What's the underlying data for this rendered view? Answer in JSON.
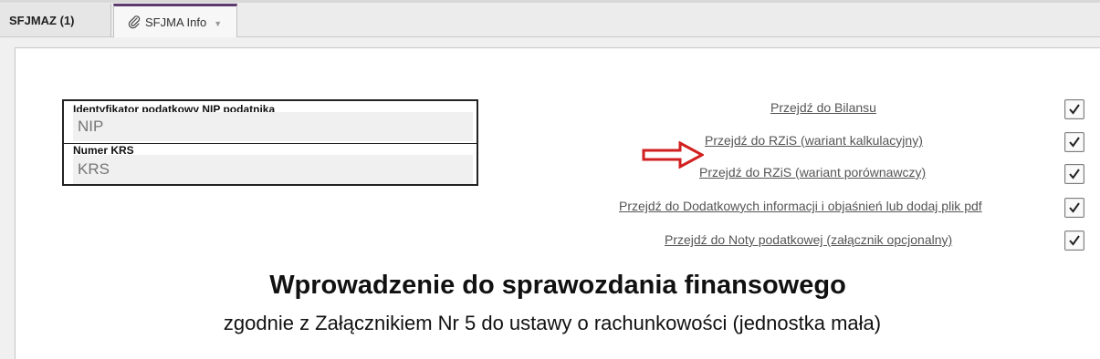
{
  "tabs": [
    {
      "label": "SFJMAZ (1)"
    },
    {
      "label": "SFJMA Info",
      "icon": "paperclip-icon",
      "dropdown_icon": "chevron-down-icon"
    }
  ],
  "identity": {
    "nip_label": "Identyfikator podatkowy NIP podatnika",
    "nip_placeholder": "NIP",
    "krs_label": "Numer KRS",
    "krs_placeholder": "KRS"
  },
  "links": [
    {
      "label": "Przejdź do Bilansu",
      "checked": true
    },
    {
      "label": "Przejdź do RZiS (wariant kalkulacyjny)",
      "checked": true
    },
    {
      "label": "Przejdź do RZiS (wariant porównawczy)",
      "checked": true
    },
    {
      "label": "Przejdź do Dodatkowych informacji i objaśnień lub dodaj plik pdf",
      "checked": true
    },
    {
      "label": "Przejdź do Noty podatkowej (załącznik opcjonalny)",
      "checked": true
    }
  ],
  "arrow": {
    "icon": "red-arrow-right-icon",
    "color": "#d21f1f"
  },
  "heading": {
    "title": "Wprowadzenie do sprawozdania finansowego",
    "subtitle": "zgodnie z Załącznikiem Nr 5 do ustawy o rachunkowości (jednostka mała)"
  },
  "colors": {
    "active_tab_accent": "#5d3a6e",
    "link": "#555555"
  }
}
